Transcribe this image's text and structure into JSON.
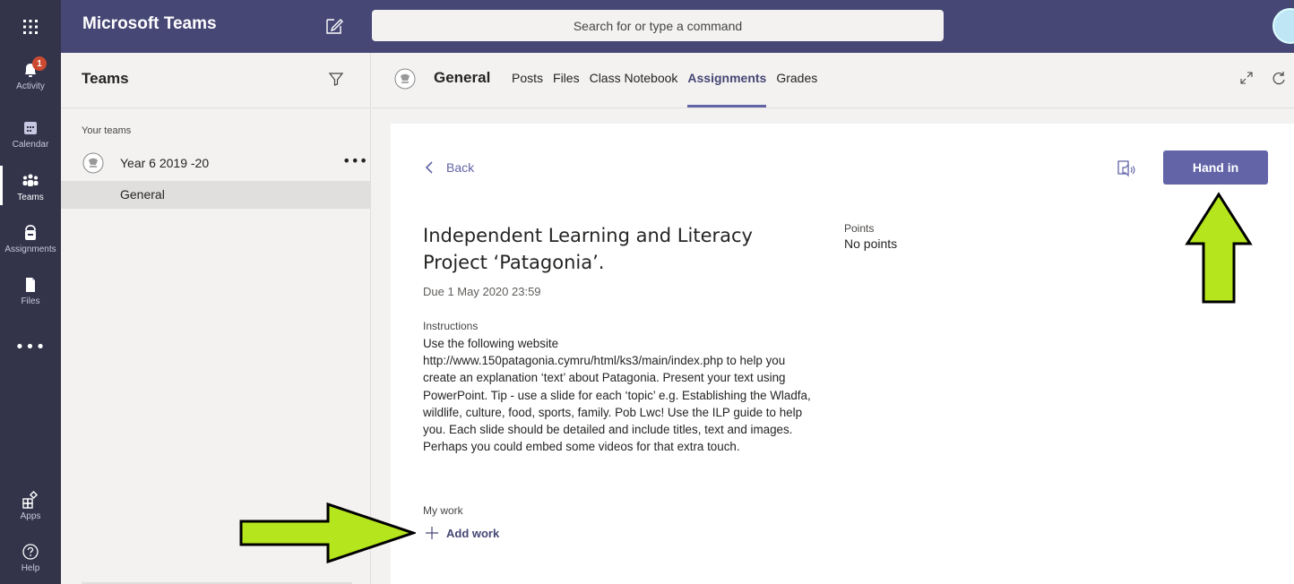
{
  "app": {
    "title": "Microsoft Teams"
  },
  "search": {
    "placeholder": "Search for or type a command"
  },
  "rail": {
    "items": [
      {
        "label": "Activity",
        "icon": "bell-icon",
        "badge": "1"
      },
      {
        "label": "Calendar",
        "icon": "calendar-icon"
      },
      {
        "label": "Teams",
        "icon": "teams-icon",
        "active": true
      },
      {
        "label": "Assignments",
        "icon": "assignments-icon"
      },
      {
        "label": "Files",
        "icon": "files-icon"
      },
      {
        "label": "Apps",
        "icon": "apps-icon"
      },
      {
        "label": "Help",
        "icon": "help-icon"
      }
    ],
    "more": "•••"
  },
  "leftpanel": {
    "title": "Teams",
    "section_label": "Your teams",
    "team_name": "Year 6 2019 -20",
    "team_more": "•••",
    "channel_name": "General"
  },
  "channel": {
    "name": "General",
    "tabs": [
      {
        "label": "Posts"
      },
      {
        "label": "Files"
      },
      {
        "label": "Class Notebook"
      },
      {
        "label": "Assignments",
        "active": true
      },
      {
        "label": "Grades"
      }
    ]
  },
  "assignment": {
    "back_label": "Back",
    "hand_in_label": "Hand in",
    "title": "Independent Learning and Literacy Project ‘Patagonia’.",
    "due": "Due 1 May 2020 23:59",
    "points_label": "Points",
    "points_value": "No points",
    "instructions_label": "Instructions",
    "instructions": "Use the following website http://www.150patagonia.cymru/html/ks3/main/index.php to help you create an explanation ‘text’ about Patagonia. Present your text using PowerPoint. Tip - use a slide for each ‘topic’ e.g. Establishing the Wladfa, wildlife, culture, food, sports, family. Pob Lwc! Use the ILP guide to help you. Each slide should be detailed and include titles, text and images. Perhaps you could embed some videos for that extra touch.",
    "my_work_label": "My work",
    "add_work_label": "Add work"
  },
  "colors": {
    "topbar": "#464775",
    "rail": "#33344a",
    "accent": "#6264a7",
    "annotation_arrow": "#b5e61d"
  }
}
